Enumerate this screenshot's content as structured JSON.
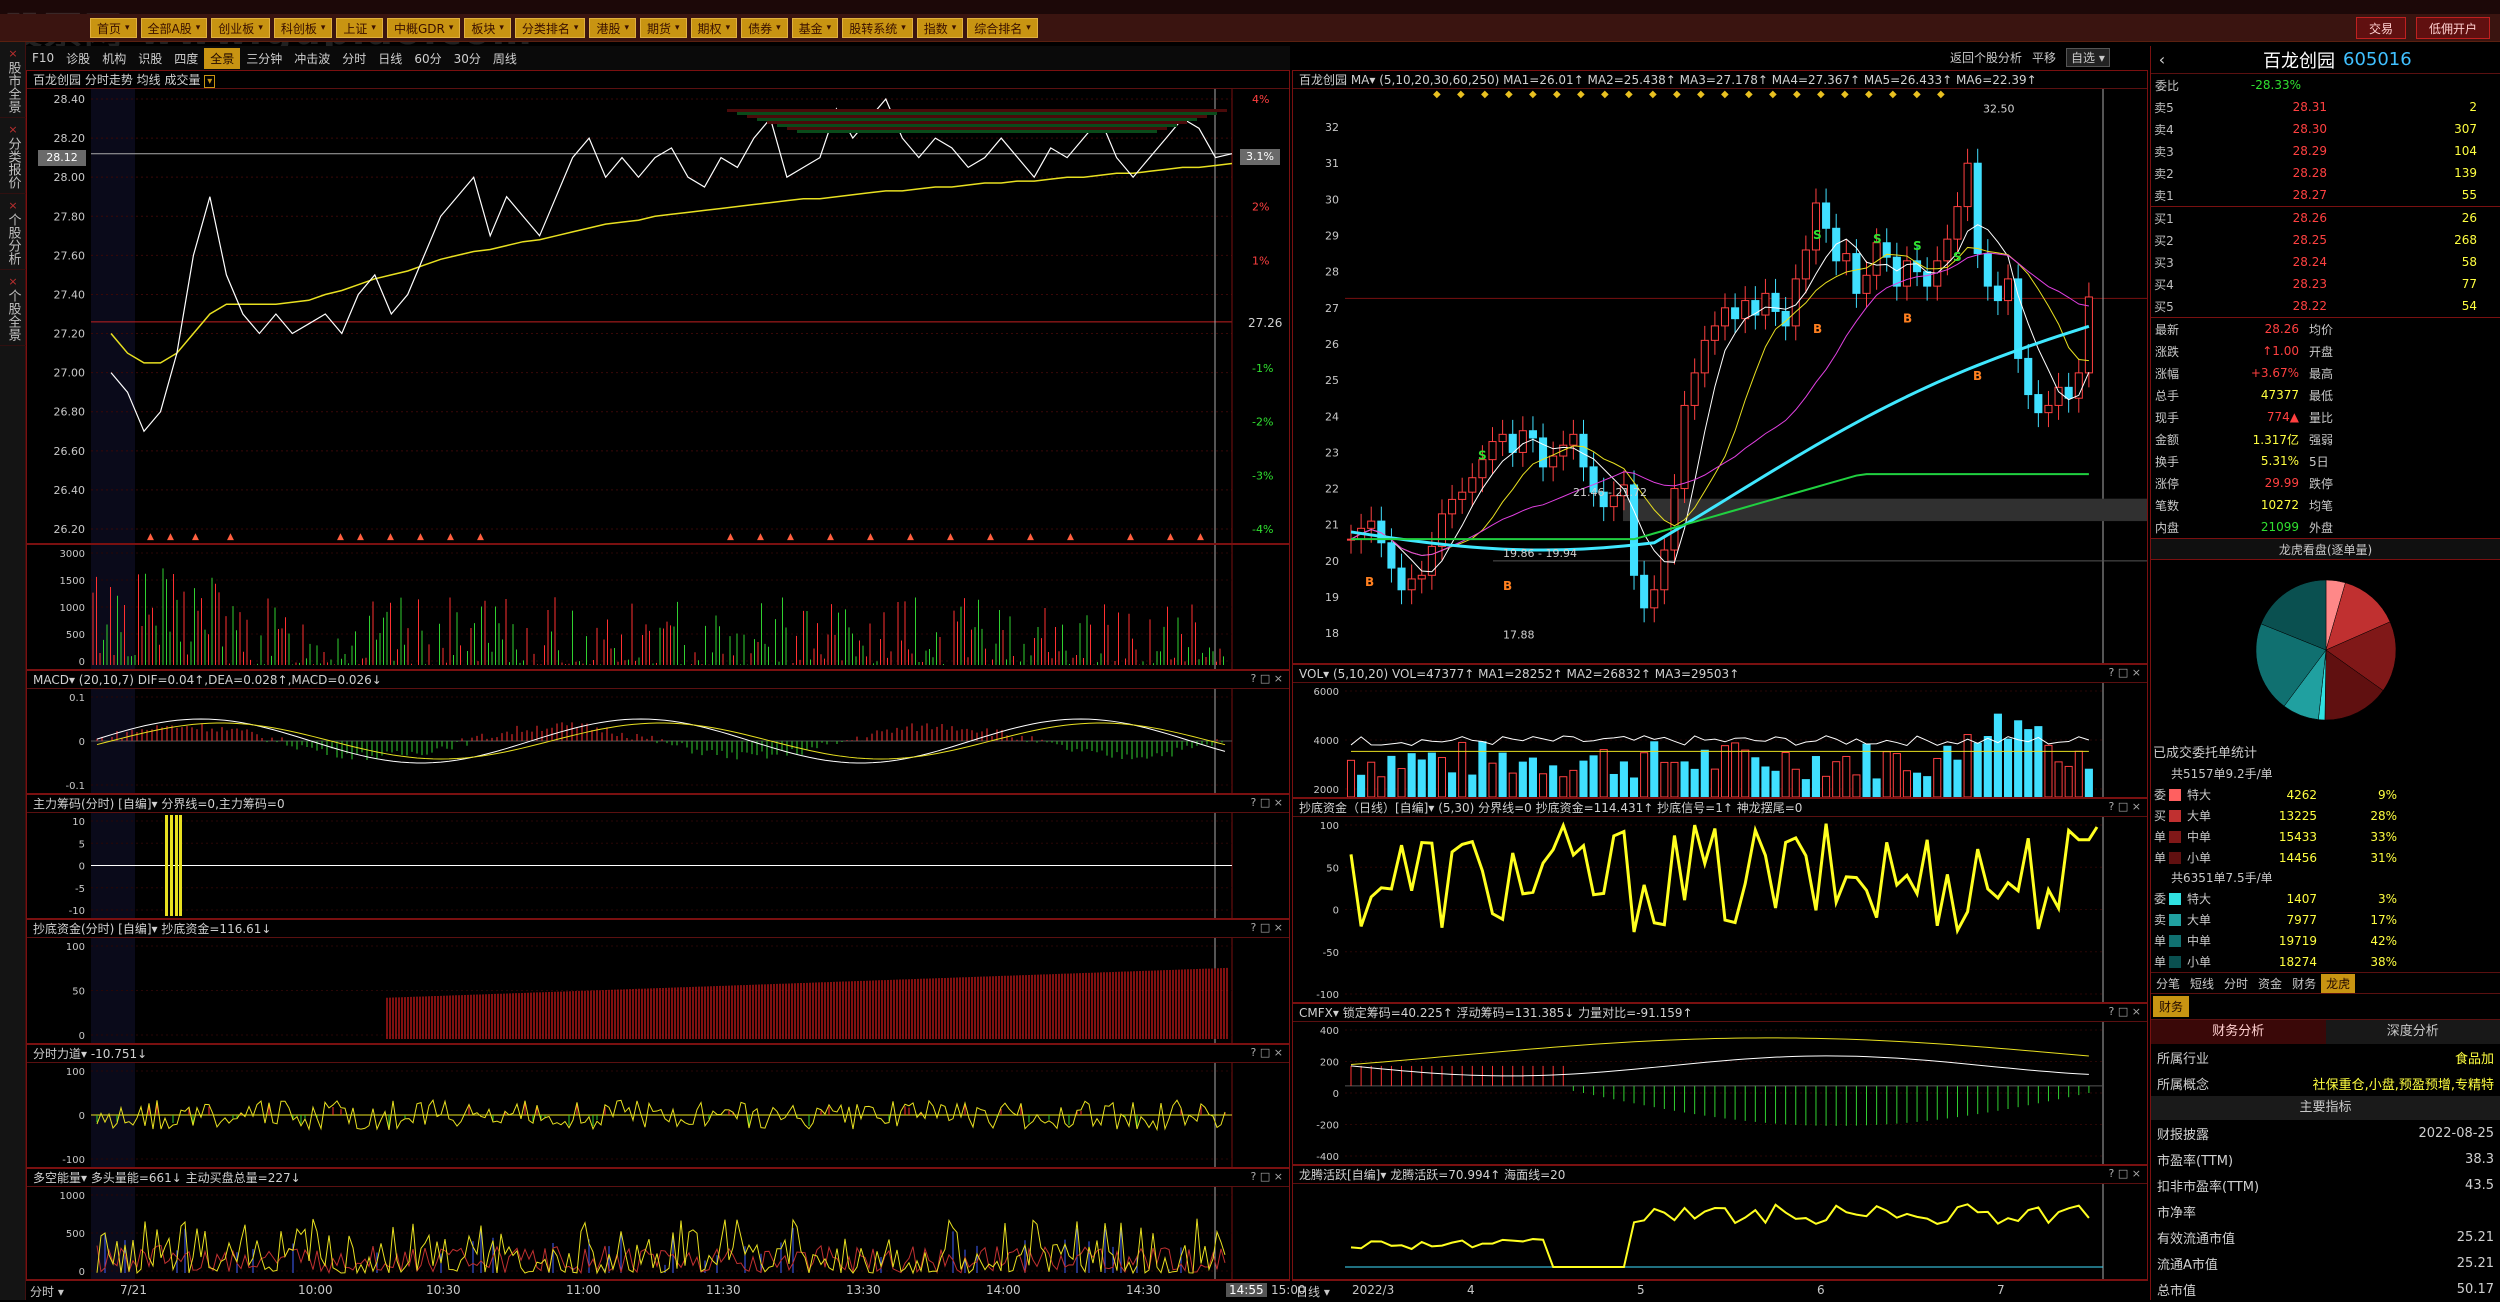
{
  "watermark": "股票网 www.gupiao.com",
  "menu": {
    "items": [
      "首页",
      "全部A股",
      "创业板",
      "科创板",
      "上证",
      "中概GDR",
      "板块",
      "分类排名",
      "港股",
      "期货",
      "期权",
      "债券",
      "基金",
      "股转系统",
      "指数",
      "综合排名"
    ],
    "right_buttons": [
      "交易",
      "低佣开户"
    ]
  },
  "left_tabs": [
    "股市全景",
    "分类报价",
    "个股分析",
    "个股全景"
  ],
  "toolbar": {
    "items": [
      "F10",
      "诊股",
      "机构",
      "识股",
      "四度",
      "全景",
      "三分钟",
      "冲击波",
      "分时",
      "日线",
      "60分",
      "30分",
      "周线"
    ],
    "active": "全景",
    "right_items": [
      "返回个股分析",
      "平移",
      "自选"
    ]
  },
  "stock": {
    "name": "百龙创园",
    "code": "605016"
  },
  "intraday": {
    "title": "百龙创园 分时走势 均线 成交量",
    "last_price": "28.12",
    "pct": "3.1%",
    "prev_close": "27.26",
    "y_left": [
      "28.40",
      "28.20",
      "28.00",
      "27.80",
      "27.60",
      "27.40",
      "27.20",
      "27.00",
      "26.80",
      "26.60",
      "26.40",
      "26.20"
    ],
    "y_right": [
      "4%",
      "3%",
      "2%",
      "1%",
      "",
      "-1%",
      "-2%",
      "-3%",
      "-4%"
    ],
    "vol_axis": [
      "3000",
      "1500",
      "1000",
      "500",
      "0"
    ],
    "price": [
      27.0,
      26.9,
      26.7,
      26.8,
      27.1,
      27.6,
      27.9,
      27.5,
      27.3,
      27.2,
      27.3,
      27.2,
      27.25,
      27.3,
      27.2,
      27.4,
      27.5,
      27.3,
      27.4,
      27.6,
      27.8,
      27.9,
      28.0,
      27.7,
      27.9,
      27.8,
      27.7,
      27.9,
      28.1,
      28.2,
      28.0,
      28.1,
      28.0,
      28.1,
      28.15,
      28.0,
      27.95,
      28.1,
      28.05,
      28.2,
      28.3,
      28.0,
      28.05,
      28.1,
      28.35,
      28.2,
      28.3,
      28.4,
      28.2,
      28.1,
      28.2,
      28.15,
      28.05,
      28.1,
      28.2,
      28.1,
      28.0,
      28.15,
      28.1,
      28.2,
      28.3,
      28.1,
      28.0,
      28.1,
      28.2,
      28.3,
      28.25,
      28.1,
      28.12
    ],
    "avg": [
      27.2,
      27.1,
      27.05,
      27.05,
      27.1,
      27.2,
      27.3,
      27.35,
      27.35,
      27.35,
      27.35,
      27.36,
      27.37,
      27.4,
      27.42,
      27.45,
      27.48,
      27.5,
      27.52,
      27.55,
      27.58,
      27.6,
      27.62,
      27.63,
      27.65,
      27.67,
      27.68,
      27.7,
      27.72,
      27.74,
      27.76,
      27.77,
      27.78,
      27.8,
      27.81,
      27.82,
      27.83,
      27.84,
      27.85,
      27.86,
      27.87,
      27.88,
      27.89,
      27.89,
      27.9,
      27.91,
      27.92,
      27.93,
      27.93,
      27.94,
      27.95,
      27.95,
      27.96,
      27.97,
      27.97,
      27.98,
      27.98,
      27.99,
      28.0,
      28.0,
      28.01,
      28.02,
      28.02,
      28.03,
      28.04,
      28.05,
      28.05,
      28.06,
      28.07
    ]
  },
  "time_axis": {
    "left_label": "分时",
    "labels": [
      "7/21",
      "10:00",
      "10:30",
      "11:00",
      "11:30",
      "13:30",
      "13:30",
      "14:00",
      "14:30",
      "14:55",
      "15:00"
    ]
  },
  "panes_left": [
    {
      "title": "MACD▾ (20,10,7) DIF=0.04↑,DEA=0.028↑,MACD=0.026↓",
      "axis": [
        "0.1",
        "0",
        "-0.1"
      ]
    },
    {
      "title": "主力筹码(分时) [自编]▾ 分界线=0,主力筹码=0",
      "axis": [
        "10",
        "5",
        "0",
        "-5",
        "-10"
      ]
    },
    {
      "title": "抄底资金(分时) [自编]▾ 抄底资金=116.61↓",
      "axis": [
        "100",
        "50",
        "0"
      ]
    },
    {
      "title": "分时力道▾ -10.751↓",
      "axis": [
        "100",
        "0",
        "-100"
      ]
    },
    {
      "title": "多空能量▾ 多头量能=661↓ 主动买盘总量=227↓",
      "axis": [
        "1000",
        "500",
        "0"
      ]
    }
  ],
  "daily": {
    "title": "百龙创园 MA▾ (5,10,20,30,60,250) MA1=26.01↑ MA2=25.438↑ MA3=27.178↑ MA4=27.367↑ MA5=26.433↑ MA6=22.39↑",
    "y_axis": [
      "32",
      "31",
      "30",
      "29",
      "28",
      "27",
      "26",
      "25",
      "24",
      "23",
      "22",
      "21",
      "20",
      "19",
      "18"
    ],
    "annotations": {
      "high": "32.50",
      "low": "17.88",
      "range1": "21.46 - 21.72",
      "range2": "19.86 - 19.94"
    },
    "closes": [
      20.6,
      20.9,
      21.1,
      20.5,
      19.8,
      19.2,
      19.5,
      19.6,
      20.4,
      21.3,
      21.7,
      21.9,
      22.3,
      22.8,
      23.3,
      23.5,
      23.0,
      23.6,
      23.4,
      22.6,
      22.9,
      23.2,
      23.5,
      22.6,
      21.9,
      21.5,
      21.8,
      22.1,
      19.6,
      18.7,
      19.2,
      20.3,
      22.0,
      24.3,
      25.2,
      26.1,
      26.5,
      27.0,
      26.7,
      27.2,
      26.8,
      27.4,
      26.9,
      26.5,
      27.8,
      28.6,
      29.9,
      29.2,
      28.3,
      28.5,
      27.4,
      27.9,
      28.8,
      28.4,
      27.6,
      28.3,
      28.0,
      27.6,
      28.3,
      28.9,
      29.8,
      31.0,
      28.5,
      27.6,
      27.2,
      27.8,
      25.6,
      24.6,
      24.1,
      24.3,
      24.8,
      24.5,
      25.2,
      27.3
    ],
    "x_axis": {
      "left_label": "日线",
      "labels": [
        "2022/3",
        "4",
        "5",
        "6",
        "7"
      ]
    }
  },
  "panes_right": [
    {
      "title": "VOL▾ (5,10,20) VOL=47377↑ MA1=28252↑ MA2=26832↑ MA3=29503↑",
      "axis": [
        "6000",
        "4000",
        "2000"
      ]
    },
    {
      "title": "抄底资金（日线）[自编]▾ (5,30) 分界线=0 抄底资金=114.431↑ 抄底信号=1↑ 神龙摆尾=0",
      "axis": [
        "100",
        "50",
        "0",
        "-50",
        "-100"
      ]
    },
    {
      "title": "CMFX▾ 锁定筹码=40.225↑ 浮动筹码=131.385↓ 力量对比=-91.159↑",
      "axis": [
        "400",
        "200",
        "0",
        "-200",
        "-400"
      ]
    },
    {
      "title": "龙腾活跃[自编]▾ 龙腾活跃=70.994↑ 海面线=20",
      "axis": []
    }
  ],
  "quote": {
    "webi_label": "委比",
    "webi": "-28.33%",
    "asks": [
      [
        "卖5",
        "28.31",
        "2"
      ],
      [
        "卖4",
        "28.30",
        "307"
      ],
      [
        "卖3",
        "28.29",
        "104"
      ],
      [
        "卖2",
        "28.28",
        "139"
      ],
      [
        "卖1",
        "28.27",
        "55"
      ]
    ],
    "bids": [
      [
        "买1",
        "28.26",
        "26"
      ],
      [
        "买2",
        "28.25",
        "268"
      ],
      [
        "买3",
        "28.24",
        "58"
      ],
      [
        "买4",
        "28.23",
        "77"
      ],
      [
        "买5",
        "28.22",
        "54"
      ]
    ],
    "stats": [
      [
        "最新",
        "28.26",
        "均价",
        ""
      ],
      [
        "涨跌",
        "↑1.00",
        "开盘",
        ""
      ],
      [
        "涨幅",
        "+3.67%",
        "最高",
        ""
      ],
      [
        "总手",
        "47377",
        "最低",
        ""
      ],
      [
        "现手",
        "774▲",
        "量比",
        ""
      ],
      [
        "金额",
        "1.317亿",
        "强弱",
        ""
      ],
      [
        "换手",
        "5.31%",
        "5日",
        ""
      ],
      [
        "涨停",
        "29.99",
        "跌停",
        ""
      ],
      [
        "笔数",
        "10272",
        "均笔",
        ""
      ],
      [
        "内盘",
        "21099",
        "外盘",
        ""
      ]
    ]
  },
  "pie_title": "龙虎看盘(逐单量)",
  "pie_slices": [
    {
      "pct": 9,
      "color": "#ff8888"
    },
    {
      "pct": 28,
      "color": "#c03030"
    },
    {
      "pct": 33,
      "color": "#801818"
    },
    {
      "pct": 31,
      "color": "#601010"
    },
    {
      "pct": 3,
      "color": "#30e0e0"
    },
    {
      "pct": 17,
      "color": "#20a0a0"
    },
    {
      "pct": 42,
      "color": "#107070"
    },
    {
      "pct": 38,
      "color": "#0a5050"
    }
  ],
  "order_stats": {
    "title": "已成交委托单统计",
    "buy_total": "共5157单9.2手/单",
    "sell_total": "共6351单7.5手/单",
    "side_buy": "委买单",
    "side_sell": "委卖单",
    "buy": [
      [
        "特大",
        "4262",
        "9%",
        "#ff6060"
      ],
      [
        "大单",
        "13225",
        "28%",
        "#c03030"
      ],
      [
        "中单",
        "15433",
        "33%",
        "#801818"
      ],
      [
        "小单",
        "14456",
        "31%",
        "#601010"
      ]
    ],
    "sell": [
      [
        "特大",
        "1407",
        "3%",
        "#30e0e0"
      ],
      [
        "大单",
        "7977",
        "17%",
        "#20a0a0"
      ],
      [
        "中单",
        "19719",
        "42%",
        "#107070"
      ],
      [
        "小单",
        "18274",
        "38%",
        "#0a5050"
      ]
    ]
  },
  "bottom_tabs": [
    "分笔",
    "短线",
    "分时",
    "资金",
    "财务",
    "龙虎"
  ],
  "finance": {
    "tab": "财务",
    "sub_tabs": [
      "财务分析",
      "深度分析"
    ],
    "rows": [
      [
        "所属行业",
        "食品加"
      ],
      [
        "所属概念",
        "社保重仓,小盘,预盈预增,专精特"
      ]
    ],
    "section": "主要指标",
    "metrics": [
      [
        "财报披露",
        "2022-08-25"
      ],
      [
        "市盈率(TTM)",
        "38.3"
      ],
      [
        "扣非市盈率(TTM)",
        "43.5"
      ],
      [
        "市净率",
        ""
      ],
      [
        "有效流通市值",
        "25.21"
      ],
      [
        "流通A市值",
        "25.21"
      ],
      [
        "总市值",
        "50.17"
      ]
    ]
  }
}
